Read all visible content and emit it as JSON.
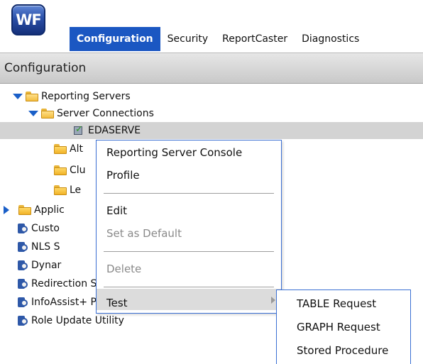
{
  "app": {
    "logo_text": "WF"
  },
  "tabs": [
    {
      "label": "Configuration",
      "active": true
    },
    {
      "label": "Security"
    },
    {
      "label": "ReportCaster"
    },
    {
      "label": "Diagnostics"
    }
  ],
  "section_title": "Configuration",
  "tree": {
    "reporting_servers": "Reporting Servers",
    "server_connections": "Server Connections",
    "edaserve": "EDASERVE",
    "alt": "Alt",
    "clu": "Clu",
    "le": "Le",
    "applic": "Applic",
    "custo": "Custo",
    "nls": "NLS S",
    "dynar": "Dynar",
    "redirection": "Redirection Settings",
    "infoassist": "InfoAssist+ Properties",
    "role_update": "Role Update Utility"
  },
  "context_menu": {
    "items": [
      {
        "label": "Reporting Server Console"
      },
      {
        "label": "Profile"
      },
      {
        "label": "Edit"
      },
      {
        "label": "Set as Default",
        "disabled": true
      },
      {
        "label": "Delete",
        "disabled": true
      },
      {
        "label": "Test"
      }
    ]
  },
  "submenu": {
    "items": [
      {
        "label": "TABLE Request"
      },
      {
        "label": "GRAPH Request"
      },
      {
        "label": "Stored Procedure"
      }
    ]
  },
  "colors": {
    "active_tab": "#1b57c2",
    "menu_border": "#3a6fd3",
    "tree_arrow": "#1a5fc8"
  }
}
